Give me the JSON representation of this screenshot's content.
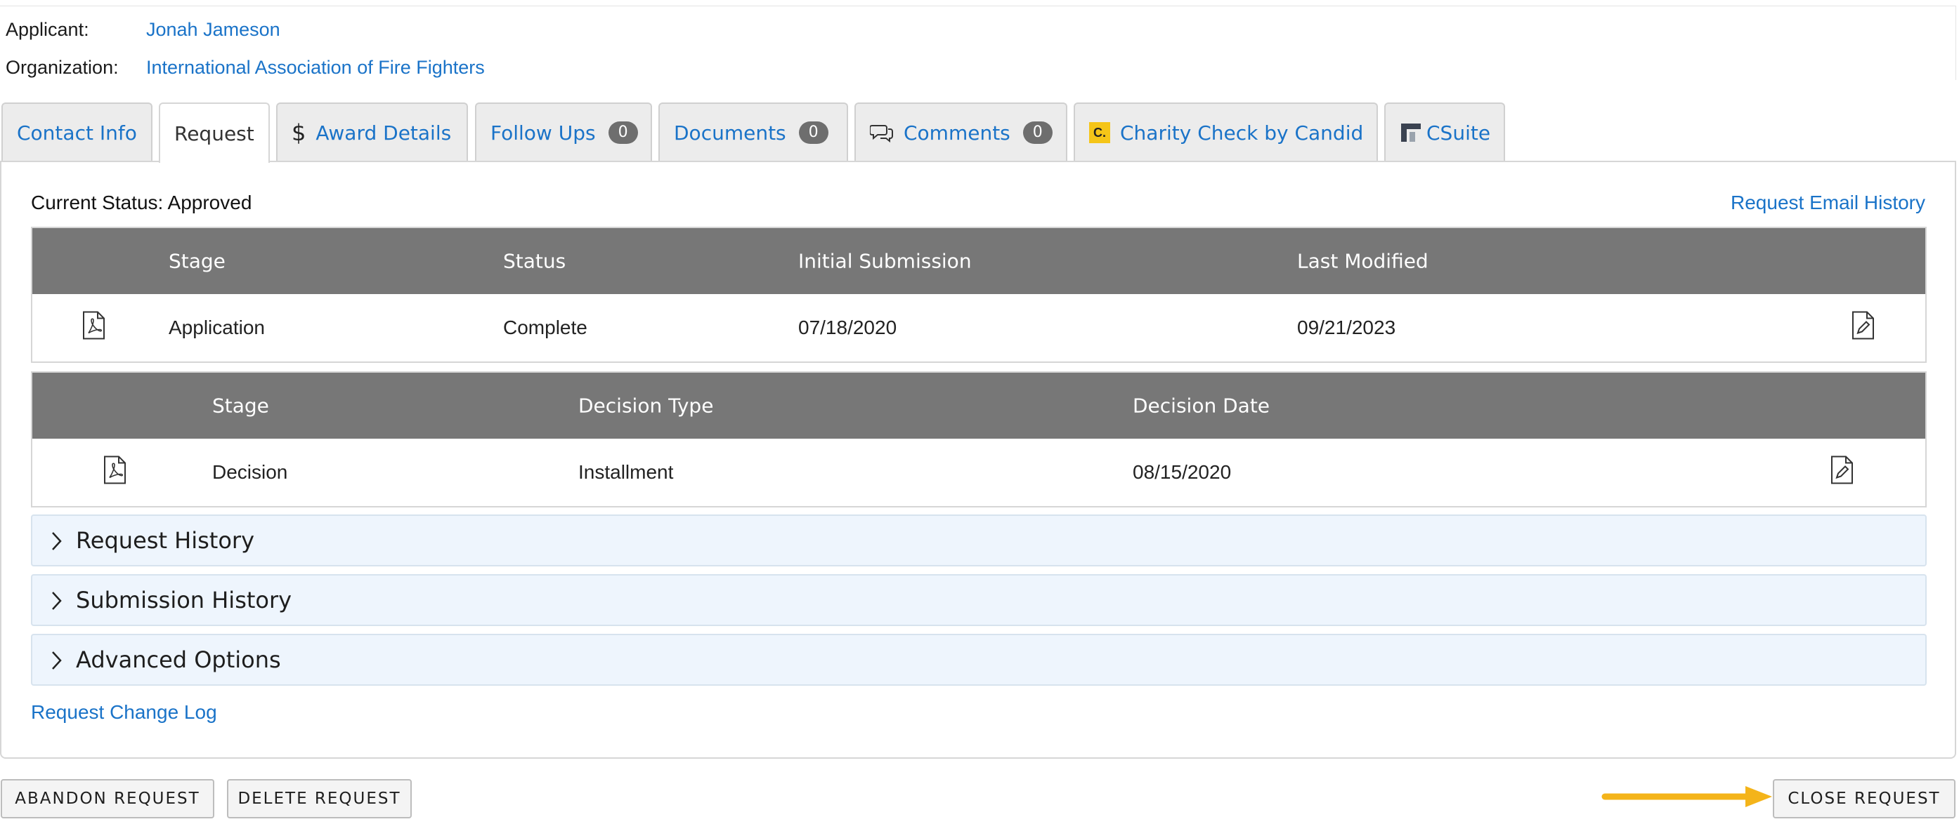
{
  "header": {
    "applicant_label": "Applicant:",
    "applicant_name": "Jonah Jameson",
    "organization_label": "Organization:",
    "organization_name": "International Association of Fire Fighters"
  },
  "tabs": [
    {
      "label": "Contact Info",
      "icon": "none"
    },
    {
      "label": "Request",
      "icon": "none",
      "active": true
    },
    {
      "label": "Award Details",
      "icon": "dollar-icon"
    },
    {
      "label": "Follow Ups",
      "badge": "0"
    },
    {
      "label": "Documents",
      "badge": "0"
    },
    {
      "label": "Comments",
      "badge": "0",
      "icon": "chat-bubbles-icon"
    },
    {
      "label": "Charity Check by Candid",
      "icon": "candid-logo-icon",
      "logo_text": "C."
    },
    {
      "label": "CSuite",
      "icon": "csuite-logo-icon"
    }
  ],
  "panel": {
    "current_status": "Current Status: Approved",
    "email_history_link": "Request Email History",
    "stages_table": {
      "columns": [
        "Stage",
        "Status",
        "Initial Submission",
        "Last Modified"
      ],
      "rows": [
        {
          "stage": "Application",
          "status": "Complete",
          "initial_submission": "07/18/2020",
          "last_modified": "09/21/2023",
          "pdf_icon": "pdf-icon",
          "edit_icon": "edit-document-icon"
        }
      ]
    },
    "decision_table": {
      "columns": [
        "Stage",
        "Decision Type",
        "Decision Date"
      ],
      "rows": [
        {
          "stage": "Decision",
          "decision_type": "Installment",
          "decision_date": "08/15/2020",
          "pdf_icon": "pdf-icon",
          "edit_icon": "edit-document-icon"
        }
      ]
    },
    "accordions": [
      {
        "label": "Request History"
      },
      {
        "label": "Submission History"
      },
      {
        "label": "Advanced Options"
      }
    ],
    "change_log_link": "Request Change Log"
  },
  "buttons": {
    "abandon": "ABANDON REQUEST",
    "delete": "DELETE REQUEST",
    "close": "CLOSE REQUEST"
  },
  "colors": {
    "link": "#1a73c8",
    "table_header_bg": "#777777",
    "accordion_bg": "#eef5fd",
    "badge_bg": "#6e6e6e",
    "annotation_arrow": "#f4b41a",
    "candid_logo_bg": "#f5c518"
  }
}
